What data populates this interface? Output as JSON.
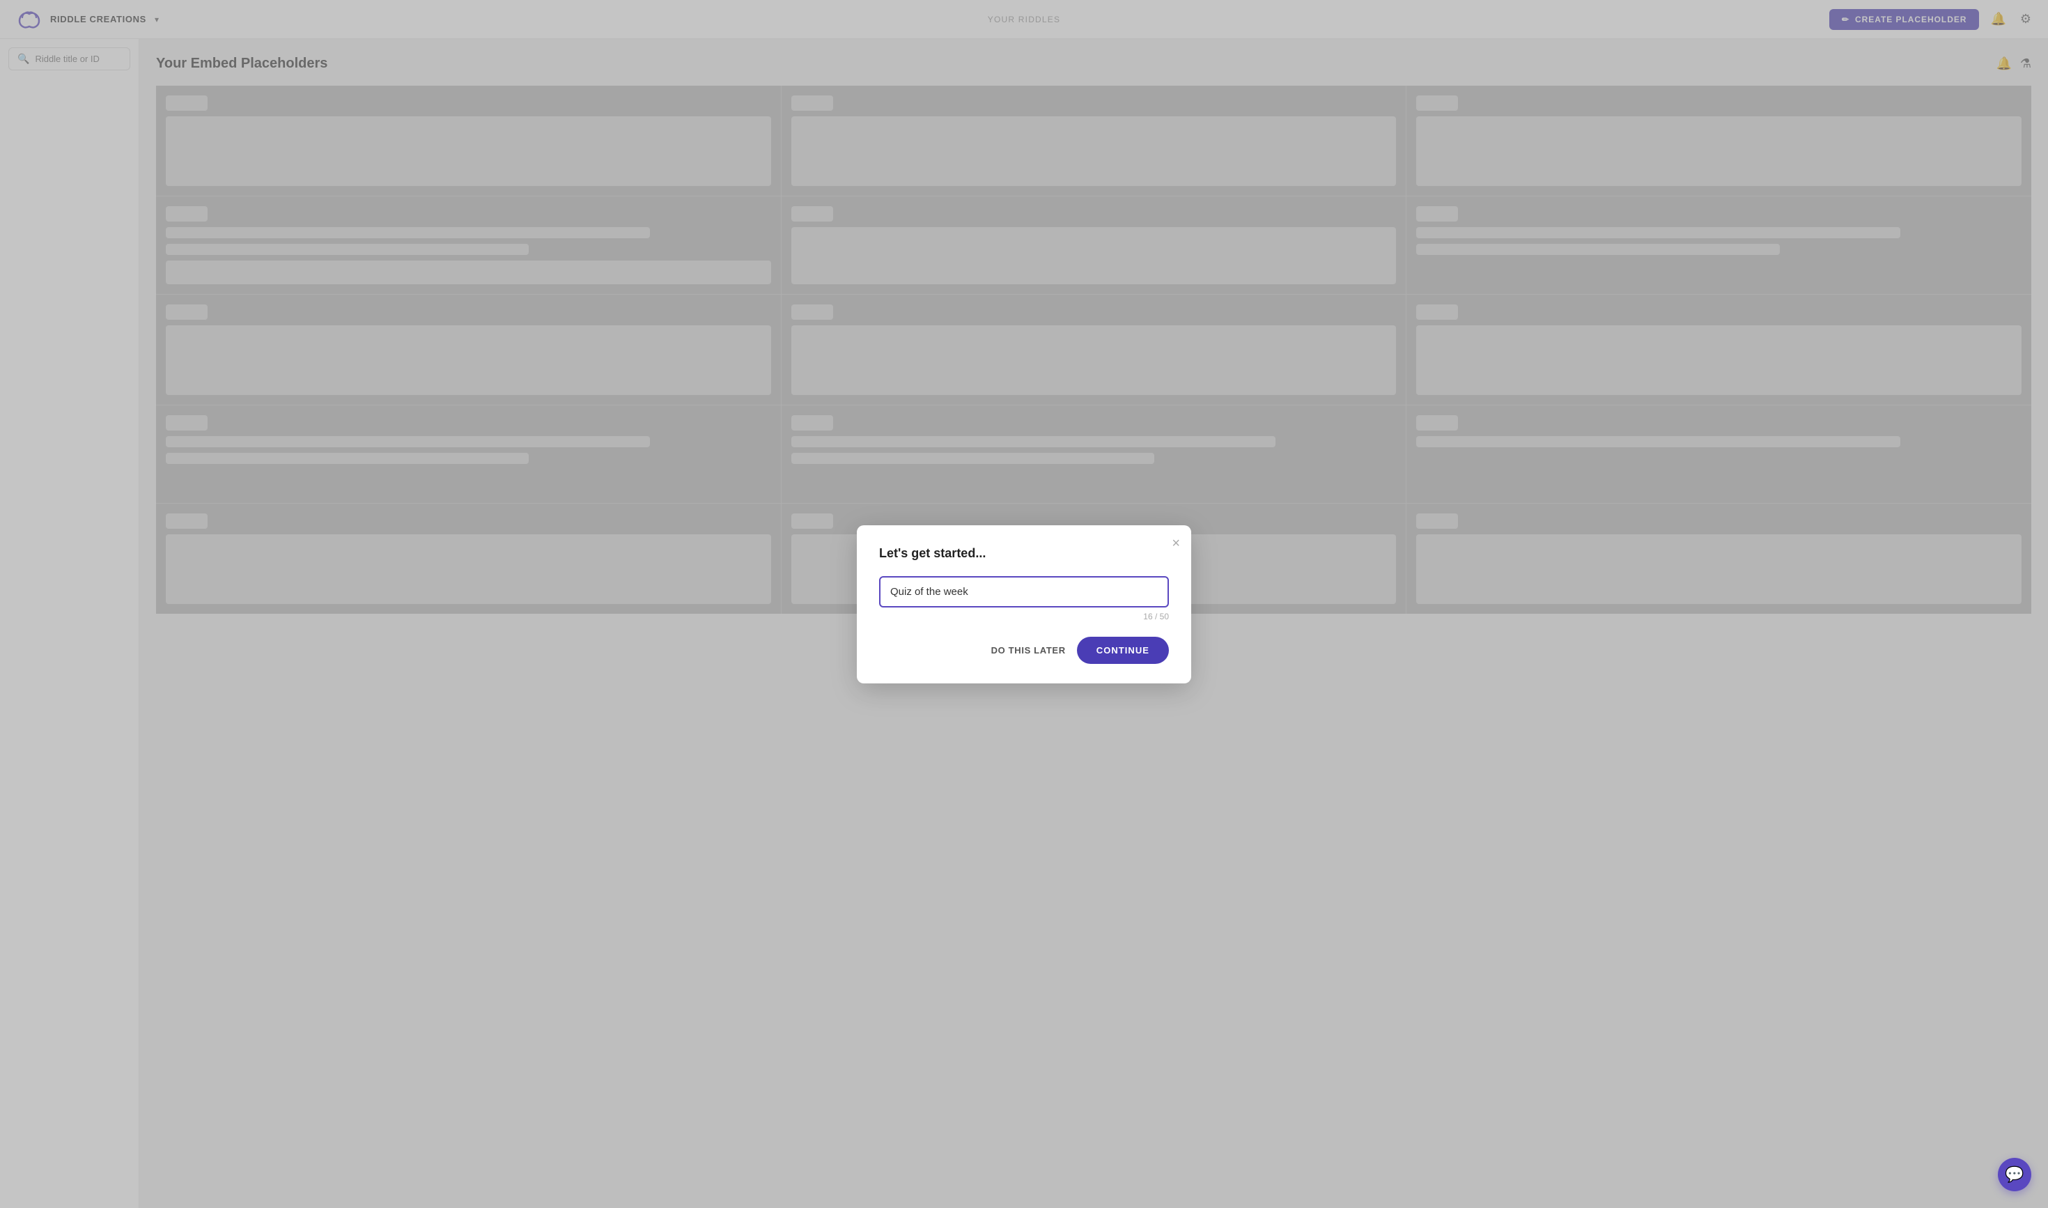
{
  "navbar": {
    "brand": "RIDDLE CREATIONS",
    "dropdown_label": "▾",
    "nav_center": "YOUR RIDDLES",
    "create_btn_label": "CREATE PLACEHOLDER",
    "create_icon": "✏",
    "bell_icon": "🔔",
    "gear_icon": "⚙"
  },
  "sidebar": {
    "search_placeholder": "Riddle title or ID"
  },
  "main": {
    "page_title": "Your Embed Placeholders",
    "bell_icon": "🔔",
    "filter_icon": "⚗"
  },
  "modal": {
    "title": "Let's get started...",
    "close_icon": "×",
    "input_value": "Quiz of the week",
    "input_placeholder": "",
    "counter": "16 / 50",
    "btn_later": "DO THIS LATER",
    "btn_continue": "CONTINUE"
  },
  "chat": {
    "icon": "💬"
  }
}
